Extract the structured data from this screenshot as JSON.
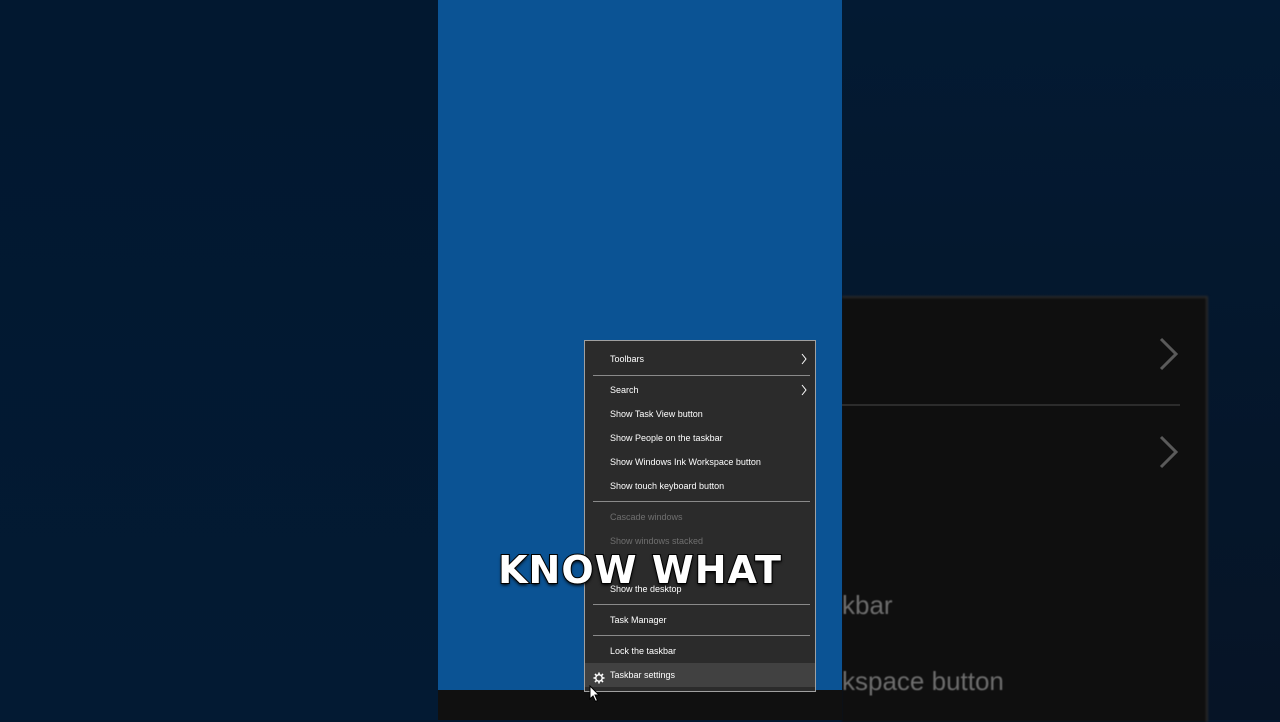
{
  "background_menu": {
    "partial_item_1": "kbar",
    "partial_item_2": "kspace button"
  },
  "context_menu": {
    "items": [
      {
        "label": "Toolbars",
        "submenu": true
      },
      {
        "label": "Search",
        "submenu": true
      },
      {
        "label": "Show Task View button"
      },
      {
        "label": "Show People on the taskbar"
      },
      {
        "label": "Show Windows Ink Workspace button"
      },
      {
        "label": "Show touch keyboard button"
      },
      {
        "label": "Cascade windows",
        "disabled": true
      },
      {
        "label": "Show windows stacked",
        "disabled": true
      },
      {
        "label": "Show the desktop"
      },
      {
        "label": "Task Manager"
      },
      {
        "label": "Lock the taskbar"
      },
      {
        "label": "Taskbar settings",
        "icon": "gear-icon",
        "hovered": true
      }
    ]
  },
  "caption": "KNOW WHAT",
  "colors": {
    "desktop": "#0b5394",
    "menu_bg": "#2b2b2b",
    "menu_text": "#ffffff",
    "disabled_text": "#6f6f6f"
  }
}
